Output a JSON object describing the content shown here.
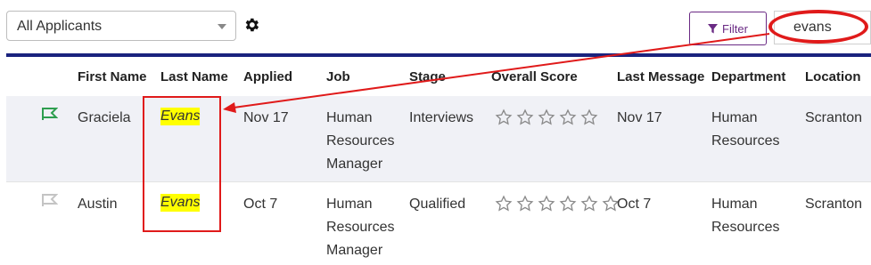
{
  "toolbar": {
    "view_select": "All Applicants",
    "filter_label": "Filter",
    "search_value": "evans"
  },
  "columns": [
    "First Name",
    "Last Name",
    "Applied",
    "Job",
    "Stage",
    "Overall Score",
    "Last Message",
    "Department",
    "Location"
  ],
  "rows": [
    {
      "flag_color": "#2e9e4f",
      "first_name": "Graciela",
      "last_name": "Evans",
      "applied": "Nov 17",
      "job": [
        "Human",
        "Resources",
        "Manager"
      ],
      "stage": "Interviews",
      "score": 0,
      "last_message": "Nov 17",
      "department": [
        "Human",
        "Resources"
      ],
      "location": "Scranton"
    },
    {
      "flag_color": "#c4c4c4",
      "first_name": "Austin",
      "last_name": "Evans",
      "applied": "Oct 7",
      "job": [
        "Human",
        "Resources",
        "Manager"
      ],
      "stage": "Qualified",
      "score": 0,
      "last_message": "Oct 7",
      "department": [
        "Human",
        "Resources"
      ],
      "location": "Scranton"
    }
  ],
  "icons": {
    "gear": "gear-icon",
    "filter": "funnel-icon",
    "flag": "flag-icon",
    "star": "star-outline-icon"
  },
  "colors": {
    "accent": "#6a2a84",
    "header_rule": "#1a237e",
    "annotation": "#e01a1a",
    "highlight": "#ffff00"
  }
}
